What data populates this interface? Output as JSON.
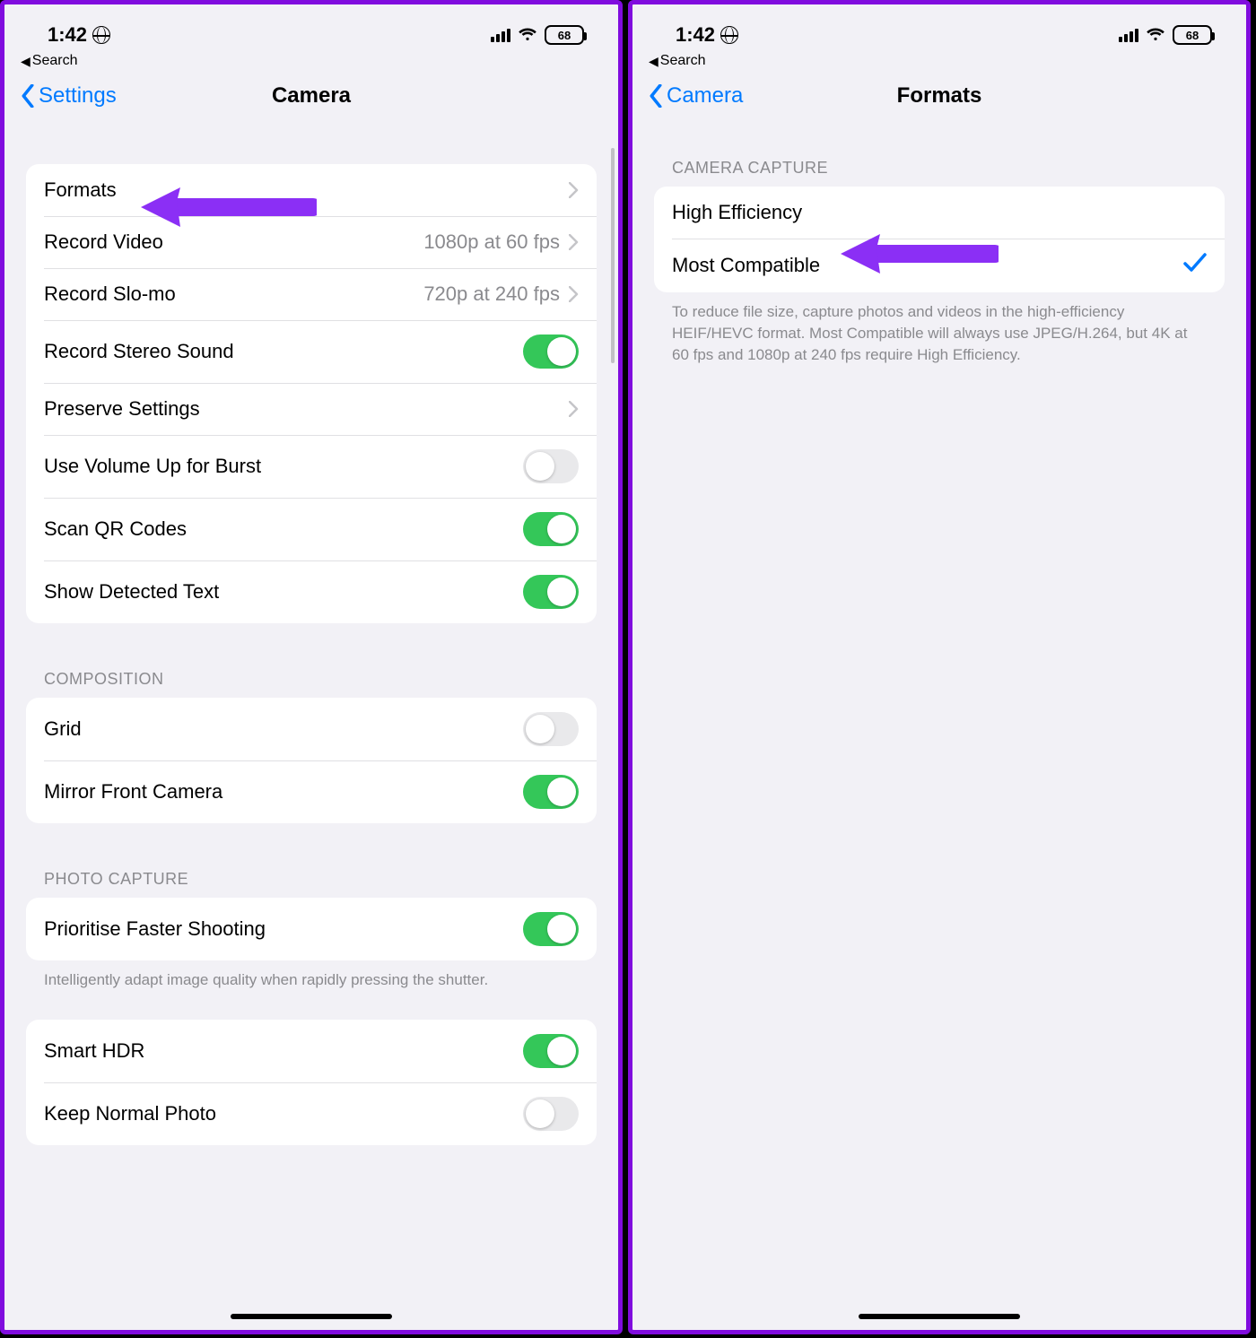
{
  "status": {
    "time": "1:42",
    "battery": "68",
    "back_search": "Search"
  },
  "left": {
    "nav_back": "Settings",
    "nav_title": "Camera",
    "rows": {
      "formats": "Formats",
      "record_video": "Record Video",
      "record_video_detail": "1080p at 60 fps",
      "record_slomo": "Record Slo-mo",
      "record_slomo_detail": "720p at 240 fps",
      "stereo": "Record Stereo Sound",
      "preserve": "Preserve Settings",
      "volume_burst": "Use Volume Up for Burst",
      "scan_qr": "Scan QR Codes",
      "detected_text": "Show Detected Text",
      "composition_header": "Composition",
      "grid": "Grid",
      "mirror": "Mirror Front Camera",
      "photo_capture_header": "Photo Capture",
      "prioritise": "Prioritise Faster Shooting",
      "prioritise_footer": "Intelligently adapt image quality when rapidly pressing the shutter.",
      "smart_hdr": "Smart HDR",
      "keep_normal": "Keep Normal Photo"
    }
  },
  "right": {
    "nav_back": "Camera",
    "nav_title": "Formats",
    "section_header": "Camera Capture",
    "high_efficiency": "High Efficiency",
    "most_compatible": "Most Compatible",
    "footer": "To reduce file size, capture photos and videos in the high-efficiency HEIF/HEVC format. Most Compatible will always use JPEG/H.264, but 4K at 60 fps and 1080p at 240 fps require High Efficiency."
  }
}
